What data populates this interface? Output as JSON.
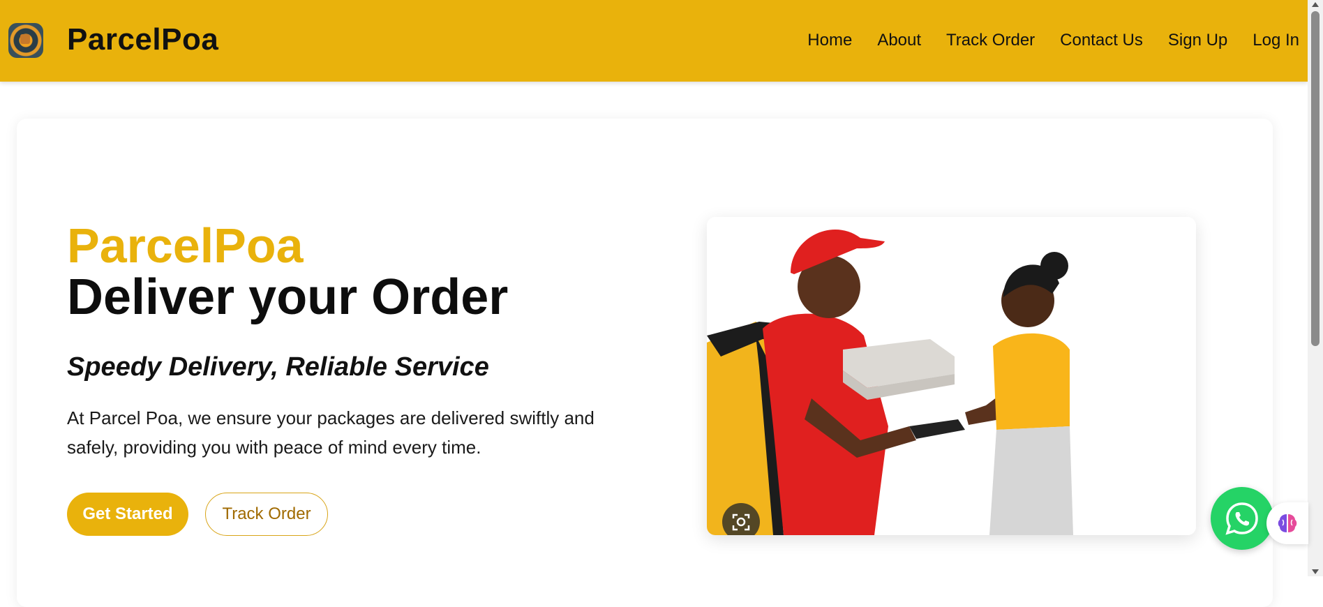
{
  "header": {
    "brand": "ParcelPoa",
    "nav": [
      "Home",
      "About",
      "Track Order",
      "Contact Us",
      "Sign Up",
      "Log In"
    ]
  },
  "hero": {
    "brand": "ParcelPoa",
    "title": "Deliver your Order",
    "subtitle": "Speedy Delivery, Reliable Service",
    "description": "At Parcel Poa, we ensure your packages are delivered swiftly and safely, providing you with peace of mind every time.",
    "primary_button": "Get Started",
    "secondary_button": "Track Order"
  },
  "colors": {
    "accent": "#e9b20c",
    "whatsapp": "#25d366",
    "secondary_text": "#a06a00"
  },
  "icons": {
    "logo": "parcelpoa-logo-icon",
    "lens": "image-search-icon",
    "whatsapp": "whatsapp-icon",
    "extension": "brain-icon"
  }
}
